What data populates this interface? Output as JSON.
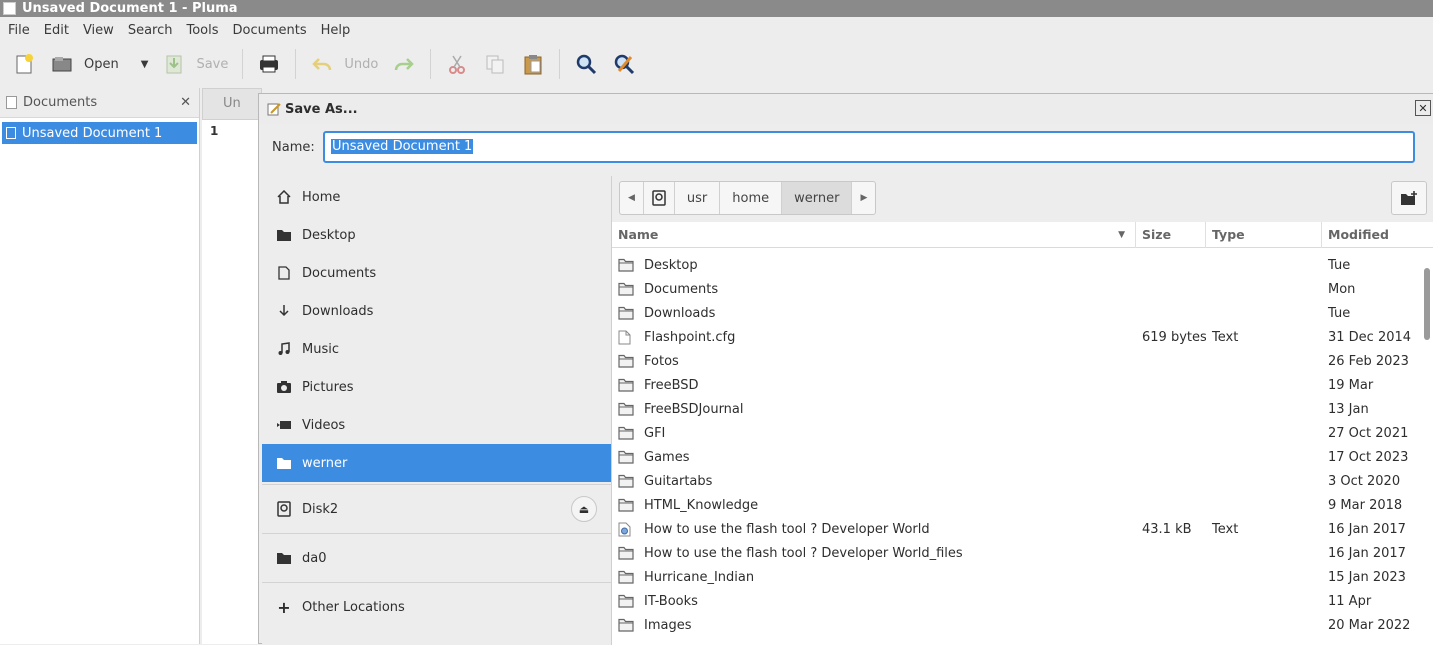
{
  "window": {
    "title": "Unsaved Document 1 - Pluma"
  },
  "menu": [
    "File",
    "Edit",
    "View",
    "Search",
    "Tools",
    "Documents",
    "Help"
  ],
  "toolbar": {
    "open_label": "Open",
    "save_label": "Save",
    "undo_label": "Undo"
  },
  "side_panel": {
    "title": "Documents",
    "items": [
      "Unsaved Document 1"
    ]
  },
  "editor": {
    "tab_label": "Un",
    "line_number": "1"
  },
  "dialog": {
    "title": "Save As...",
    "name_label": "Name:",
    "name_value": "Unsaved Document 1",
    "places": [
      {
        "label": "Home",
        "icon": "home-icon"
      },
      {
        "label": "Desktop",
        "icon": "folder-icon"
      },
      {
        "label": "Documents",
        "icon": "document-icon"
      },
      {
        "label": "Downloads",
        "icon": "download-icon"
      },
      {
        "label": "Music",
        "icon": "music-icon"
      },
      {
        "label": "Pictures",
        "icon": "camera-icon"
      },
      {
        "label": "Videos",
        "icon": "video-icon"
      },
      {
        "label": "werner",
        "icon": "folder-icon"
      }
    ],
    "devices": [
      {
        "label": "Disk2",
        "icon": "disk-icon"
      },
      {
        "label": "da0",
        "icon": "folder-icon"
      }
    ],
    "other_locations": "Other Locations",
    "path": [
      "usr",
      "home",
      "werner"
    ],
    "columns": {
      "name": "Name",
      "size": "Size",
      "type": "Type",
      "modified": "Modified"
    },
    "files": [
      {
        "name": "Desktop",
        "size": "",
        "type": "",
        "modified": "Tue",
        "kind": "folder"
      },
      {
        "name": "Documents",
        "size": "",
        "type": "",
        "modified": "Mon",
        "kind": "folder"
      },
      {
        "name": "Downloads",
        "size": "",
        "type": "",
        "modified": "Tue",
        "kind": "folder"
      },
      {
        "name": "Flashpoint.cfg",
        "size": "619 bytes",
        "type": "Text",
        "modified": "31 Dec 2014",
        "kind": "file"
      },
      {
        "name": "Fotos",
        "size": "",
        "type": "",
        "modified": "26 Feb 2023",
        "kind": "folder"
      },
      {
        "name": "FreeBSD",
        "size": "",
        "type": "",
        "modified": "19 Mar",
        "kind": "folder"
      },
      {
        "name": "FreeBSDJournal",
        "size": "",
        "type": "",
        "modified": "13 Jan",
        "kind": "folder"
      },
      {
        "name": "GFI",
        "size": "",
        "type": "",
        "modified": "27 Oct 2021",
        "kind": "folder"
      },
      {
        "name": "Games",
        "size": "",
        "type": "",
        "modified": "17 Oct 2023",
        "kind": "folder"
      },
      {
        "name": "Guitartabs",
        "size": "",
        "type": "",
        "modified": "3 Oct 2020",
        "kind": "folder"
      },
      {
        "name": "HTML_Knowledge",
        "size": "",
        "type": "",
        "modified": "9 Mar 2018",
        "kind": "folder"
      },
      {
        "name": "How to use the flash tool ? Developer World",
        "size": "43.1 kB",
        "type": "Text",
        "modified": "16 Jan 2017",
        "kind": "html"
      },
      {
        "name": "How to use the flash tool ? Developer World_files",
        "size": "",
        "type": "",
        "modified": "16 Jan 2017",
        "kind": "folder"
      },
      {
        "name": "Hurricane_Indian",
        "size": "",
        "type": "",
        "modified": "15 Jan 2023",
        "kind": "folder"
      },
      {
        "name": "IT-Books",
        "size": "",
        "type": "",
        "modified": "11 Apr",
        "kind": "folder"
      },
      {
        "name": "Images",
        "size": "",
        "type": "",
        "modified": "20 Mar 2022",
        "kind": "folder"
      }
    ]
  }
}
